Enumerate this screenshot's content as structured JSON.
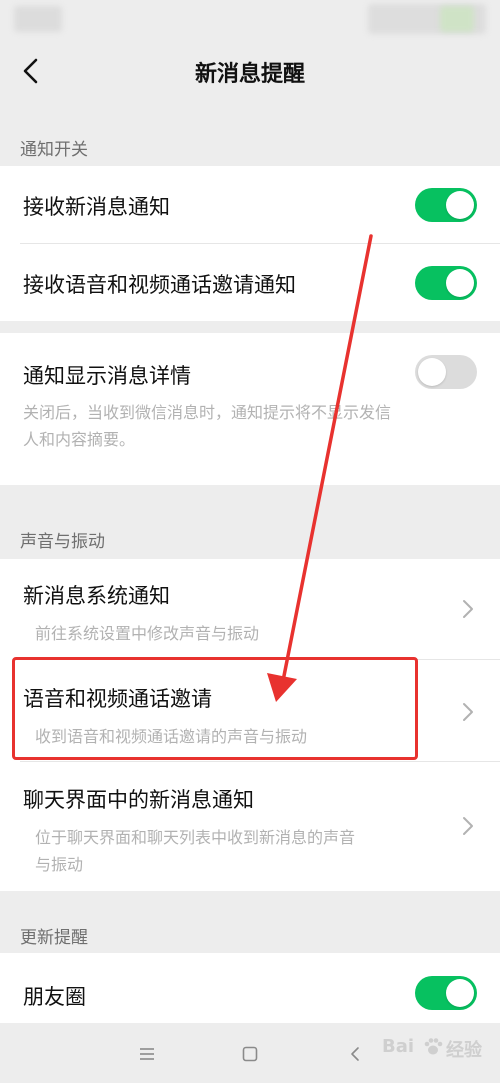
{
  "header": {
    "title": "新消息提醒"
  },
  "sections": {
    "notify_switch": "通知开关",
    "sound_vibration": "声音与振动",
    "updates": "更新提醒"
  },
  "toggles": [
    {
      "label": "接收新消息通知",
      "state": "on"
    },
    {
      "label": "接收语音和视频通话邀请通知",
      "state": "on"
    },
    {
      "label": "通知显示消息详情",
      "state": "off",
      "desc_line1": "关闭后，当收到微信消息时，通知提示将不显示发信",
      "desc_line2": "人和内容摘要。"
    }
  ],
  "links": [
    {
      "label": "新消息系统通知",
      "desc_line1": "前往系统设置中修改声音与振动"
    },
    {
      "label": "语音和视频通话邀请",
      "desc_line1": "收到语音和视频通话邀请的声音与振动"
    },
    {
      "label": "聊天界面中的新消息通知",
      "desc_line1": "位于聊天界面和聊天列表中收到新消息的声音",
      "desc_line2": "与振动"
    }
  ],
  "moments": {
    "label": "朋友圈",
    "state": "on"
  },
  "watermark": {
    "brand_a": "Bai",
    "brand_b": "经验"
  },
  "colors": {
    "accent_green": "#07c160",
    "annotation_red": "#e8322f",
    "background": "#ededed"
  },
  "icons": {
    "back": "chevron-left-icon",
    "row_arrow": "chevron-right-icon",
    "menu": "menu-icon",
    "home": "home-square-icon",
    "sys_back": "back-arrow-icon"
  }
}
